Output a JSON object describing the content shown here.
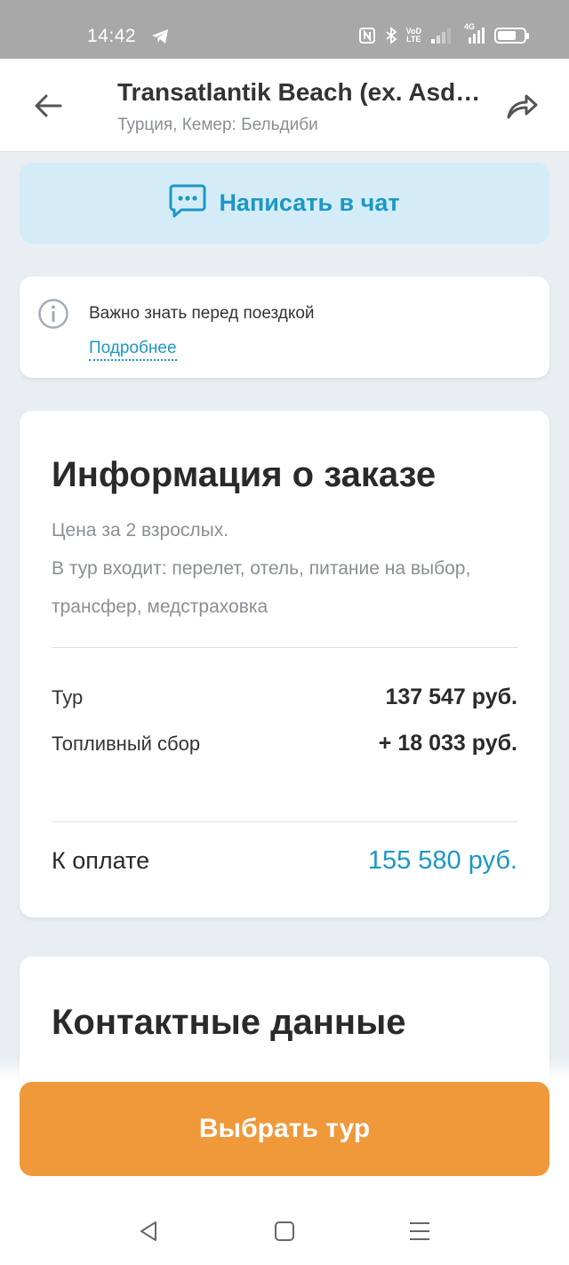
{
  "status_bar": {
    "time": "14:42",
    "network_label_1": "VoD",
    "network_label_2": "LTE",
    "network_type": "4G",
    "icons": [
      "telegram-icon",
      "nfc-icon",
      "bluetooth-icon",
      "signal-icon",
      "battery-icon"
    ],
    "battery_level": 0.7
  },
  "header": {
    "title": "Transatlantik Beach (ex. Asdem Beach Labada)",
    "subtitle": "Турция, Кемер: Бельдиби"
  },
  "chat_button": {
    "label": "Написать в чат"
  },
  "notice": {
    "text": "Важно знать перед поездкой",
    "link": "Подробнее"
  },
  "order": {
    "title": "Информация о заказе",
    "price_note": "Цена за 2 взрослых.",
    "includes": "В тур входит: перелет, отель, питание на выбор, трансфер, медстраховка",
    "tour_label": "Тур",
    "tour_value": "137 547 руб.",
    "fuel_label": "Топливный сбор",
    "fuel_value": "+ 18 033 руб.",
    "total_label": "К оплате",
    "total_value": "155 580 руб."
  },
  "contacts": {
    "title": "Контактные данные"
  },
  "cta": {
    "label": "Выбрать тур"
  },
  "colors": {
    "accent_blue": "#1c97c6",
    "chat_bg": "#d3ecf7",
    "cta_orange": "#f0993a",
    "page_bg": "#e9eef2"
  }
}
